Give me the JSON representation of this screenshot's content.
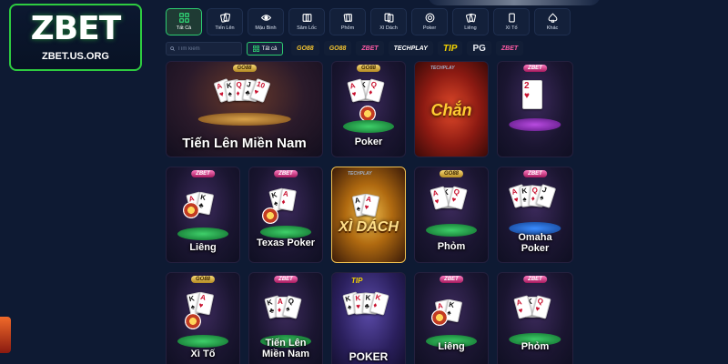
{
  "logo": {
    "word": "ZBET",
    "url": "ZBET.US.ORG"
  },
  "tabs": [
    {
      "label": "Tất Cả",
      "icon": "grid-icon",
      "active": true
    },
    {
      "label": "Tiến Lên",
      "icon": "cards-icon",
      "active": false
    },
    {
      "label": "Mậu Binh",
      "icon": "eye-icon",
      "active": false
    },
    {
      "label": "Sâm Lốc",
      "icon": "cards-icon",
      "active": false
    },
    {
      "label": "Phỏm",
      "icon": "cards-icon",
      "active": false
    },
    {
      "label": "Xì Dách",
      "icon": "cards-icon",
      "active": false
    },
    {
      "label": "Poker",
      "icon": "chip-icon",
      "active": false
    },
    {
      "label": "Liêng",
      "icon": "cards-icon",
      "active": false
    },
    {
      "label": "Xì Tố",
      "icon": "card-icon",
      "active": false
    },
    {
      "label": "Khác",
      "icon": "spade-icon",
      "active": false
    }
  ],
  "filter": {
    "search_placeholder": "Tìm kiếm",
    "all_label": "Tất cả"
  },
  "providers": [
    {
      "label": "GO88",
      "style": "gold"
    },
    {
      "label": "GO88",
      "style": "gold"
    },
    {
      "label": "ZBET",
      "style": "pink"
    },
    {
      "label": "TECHPLAY",
      "style": "white"
    },
    {
      "label": "TIP",
      "style": "tip"
    },
    {
      "label": "PG",
      "style": "pg"
    },
    {
      "label": "ZBET",
      "style": "pink"
    }
  ],
  "games": [
    {
      "title": "Tiến Lên Miền Nam",
      "badge": "GO88"
    },
    {
      "title": "Poker",
      "badge": "GO88"
    },
    {
      "title": "Chắn",
      "badge": "TECHPLAY"
    },
    {
      "title": "",
      "badge": "ZBET"
    },
    {
      "title": "Liêng",
      "badge": "ZBET"
    },
    {
      "title": "Texas Poker",
      "badge": "ZBET"
    },
    {
      "title": "XÌ DÁCH",
      "badge": "TECHPLAY"
    },
    {
      "title": "Phỏm",
      "badge": "GO88"
    },
    {
      "title": "Omaha Poker",
      "badge": "ZBET"
    },
    {
      "title": "Xì Tố",
      "badge": "GO88"
    },
    {
      "title": "Tiến Lên Miền Nam",
      "badge": "ZBET"
    },
    {
      "title": "POKER",
      "badge": "TIP"
    },
    {
      "title": "Liêng",
      "badge": "ZBET"
    },
    {
      "title": "Phỏm",
      "badge": "ZBET"
    }
  ],
  "colors": {
    "background": "#0e1a33",
    "accent": "#2ecc71",
    "gold": "#f4c430"
  }
}
